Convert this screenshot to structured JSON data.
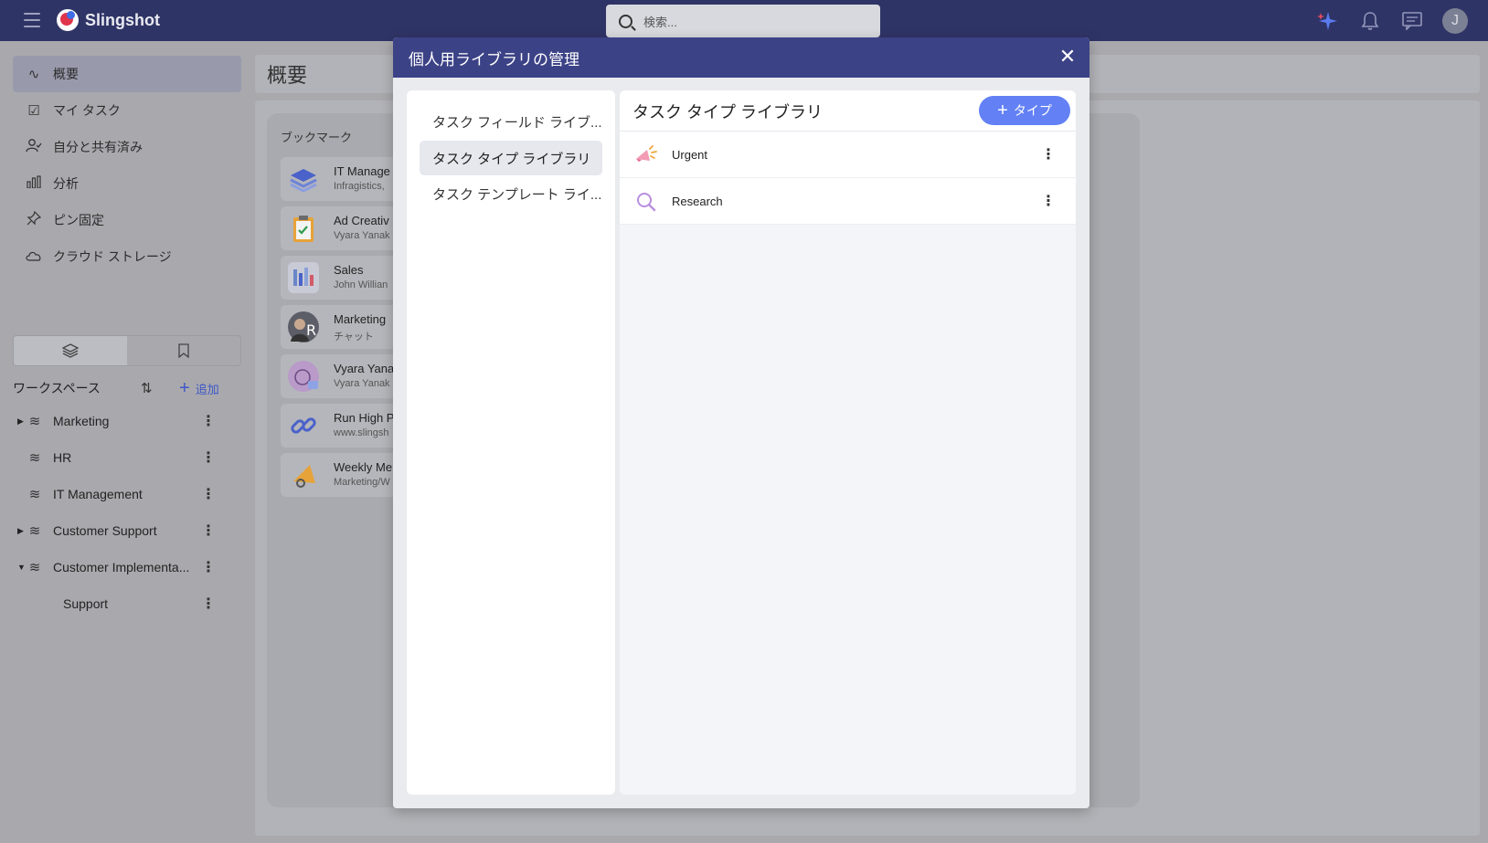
{
  "app": {
    "name": "Slingshot",
    "search_placeholder": "検索...",
    "user_initial": "J"
  },
  "nav": {
    "items": [
      {
        "label": "概要",
        "icon": "activity-icon"
      },
      {
        "label": "マイ タスク",
        "icon": "clipboard-check-icon"
      },
      {
        "label": "自分と共有済み",
        "icon": "user-check-icon"
      },
      {
        "label": "分析",
        "icon": "bar-chart-icon"
      },
      {
        "label": "ピン固定",
        "icon": "pin-icon"
      },
      {
        "label": "クラウド ストレージ",
        "icon": "cloud-icon"
      }
    ]
  },
  "workspaces": {
    "title": "ワークスペース",
    "add_label": "追加",
    "items": [
      {
        "label": "Marketing",
        "caret": "▶"
      },
      {
        "label": "HR",
        "caret": ""
      },
      {
        "label": "IT Management",
        "caret": ""
      },
      {
        "label": "Customer Support",
        "caret": "▶"
      },
      {
        "label": "Customer Implementa...",
        "caret": "▼"
      },
      {
        "label": "Support",
        "caret": ""
      }
    ]
  },
  "main": {
    "title": "概要",
    "bookmarks_label": "ブックマーク",
    "bookmarks": [
      {
        "name": "IT Manage",
        "sub": "Infragistics,"
      },
      {
        "name": "Ad Creativ",
        "sub": "Vyara Yanak"
      },
      {
        "name": "Sales",
        "sub": "John Willian"
      },
      {
        "name": "Marketing",
        "sub": "チャット"
      },
      {
        "name": "Vyara Yana",
        "sub": "Vyara Yanak"
      },
      {
        "name": "Run High P",
        "sub": "www.slingsh"
      },
      {
        "name": "Weekly Me",
        "sub": "Marketing/W"
      }
    ]
  },
  "modal": {
    "title": "個人用ライブラリの管理",
    "tabs": [
      {
        "label": "タスク フィールド ライブ..."
      },
      {
        "label": "タスク タイプ ライブラリ"
      },
      {
        "label": "タスク テンプレート ライ..."
      }
    ],
    "right_title": "タスク タイプ ライブラリ",
    "add_button_label": "タイプ",
    "types": [
      {
        "label": "Urgent",
        "icon": "megaphone-icon"
      },
      {
        "label": "Research",
        "icon": "search-icon"
      }
    ]
  },
  "colors": {
    "topbar": "#2f3466",
    "modal_header": "#3c4286",
    "accent": "#6381f4"
  }
}
